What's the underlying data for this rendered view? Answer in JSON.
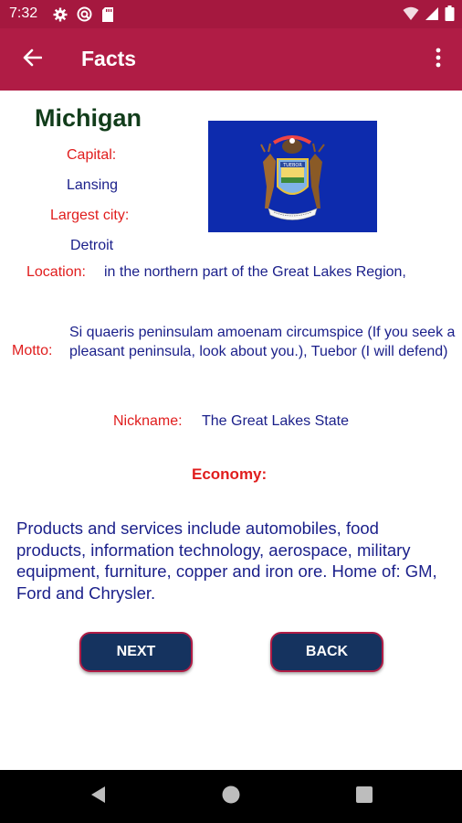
{
  "status_bar": {
    "time": "7:32"
  },
  "app_bar": {
    "title": "Facts"
  },
  "state": {
    "name": "Michigan",
    "capital_label": "Capital:",
    "capital": "Lansing",
    "largest_city_label": "Largest city:",
    "largest_city": "Detroit",
    "location_label": "Location:",
    "location": "in the northern part of the Great Lakes Region,",
    "motto_label": "Motto:",
    "motto": "Si quaeris peninsulam amoenam circumspice (If you seek a pleasant peninsula, look about you.), Tuebor (I will defend)",
    "nickname_label": "Nickname:",
    "nickname": "The Great Lakes State",
    "economy_label": "Economy:",
    "economy": "Products and services include automobiles, food products, information technology, aerospace, military equipment, furniture, copper and iron ore. Home of: GM, Ford and Chrysler.",
    "flag_motto_text": "TUEBOR"
  },
  "buttons": {
    "next": "NEXT",
    "back": "BACK"
  },
  "colors": {
    "app_bar": "#b01c45",
    "status_bar": "#a5183f",
    "label_red": "#e01d1d",
    "value_blue": "#1a1f8a",
    "button_navy": "#15335f",
    "flag_blue": "#0d2bad",
    "state_name_green": "#123d1b"
  },
  "icons": {
    "status": [
      "settings-icon",
      "vpn-key-icon",
      "sd-card-icon",
      "wifi-icon",
      "signal-icon",
      "battery-icon"
    ],
    "app_bar": [
      "arrow-back-icon",
      "more-vert-icon"
    ],
    "nav": [
      "nav-back-icon",
      "nav-home-icon",
      "nav-recents-icon"
    ]
  }
}
